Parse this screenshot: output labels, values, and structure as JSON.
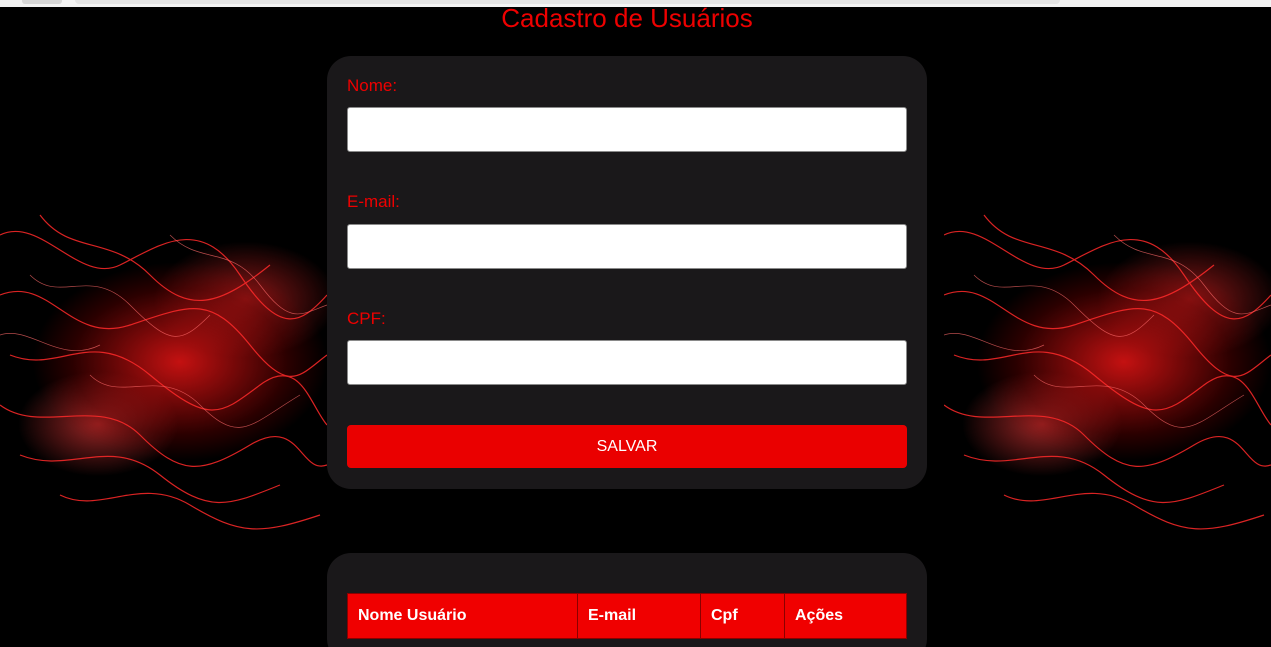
{
  "page": {
    "title": "Cadastro de Usuários"
  },
  "form": {
    "fields": [
      {
        "label": "Nome:",
        "value": "",
        "placeholder": ""
      },
      {
        "label": "E-mail:",
        "value": "",
        "placeholder": ""
      },
      {
        "label": "CPF:",
        "value": "",
        "placeholder": ""
      }
    ],
    "save_label": "SALVAR"
  },
  "table": {
    "headers": [
      "Nome Usuário",
      "E-mail",
      "Cpf",
      "Ações"
    ]
  },
  "colors": {
    "accent": "#ee0000",
    "button": "#ea0000",
    "card_bg": "#1a181a",
    "page_bg": "#000000"
  },
  "decorations": {
    "background_art": "red-flame-art"
  }
}
